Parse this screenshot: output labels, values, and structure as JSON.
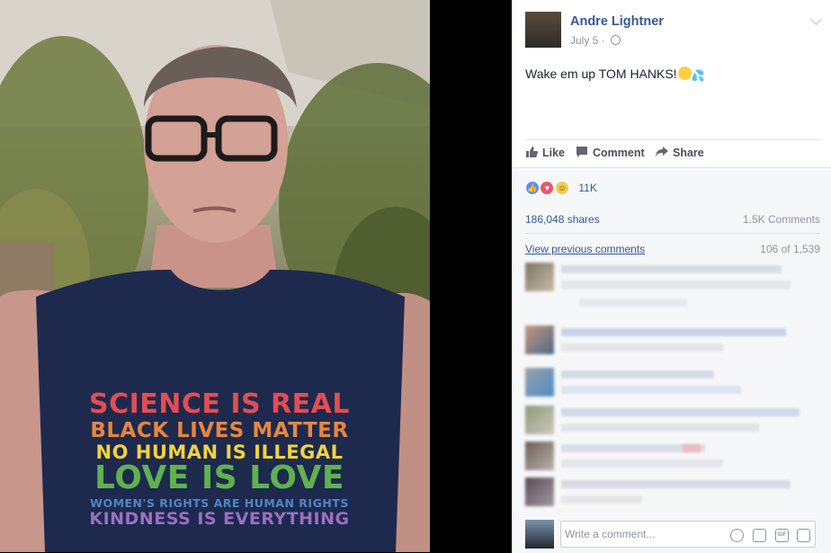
{
  "photo": {
    "shirt_lines": [
      "SCIENCE IS REAL",
      "BLACK LIVES MATTER",
      "NO HUMAN IS ILLEGAL",
      "LOVE IS LOVE",
      "WOMEN'S RIGHTS ARE HUMAN RIGHTS",
      "KINDNESS IS EVERYTHING"
    ]
  },
  "post": {
    "author": "Andre Lightner",
    "date": "July 5",
    "separator": "·",
    "caption": "Wake em up TOM HANKS!",
    "caption_emojis": [
      "grinning-sweat-emoji",
      "sweat-droplets-emoji"
    ]
  },
  "actions": {
    "like": "Like",
    "comment": "Comment",
    "share": "Share"
  },
  "stats": {
    "reactions": [
      "like",
      "love",
      "haha"
    ],
    "reaction_count": "11K",
    "shares": "186,048 shares",
    "comments": "1.5K Comments",
    "view_previous": "View previous comments",
    "count_of": "106 of 1,539"
  },
  "composer": {
    "placeholder": "Write a comment...",
    "tools": [
      "emoji-icon",
      "camera-icon",
      "gif-icon",
      "sticker-icon"
    ]
  },
  "colors": {
    "link": "#365899",
    "muted": "#90949c",
    "like_blue": "#5890ff",
    "love_red": "#f25268",
    "haha_yellow": "#f7c94b"
  }
}
